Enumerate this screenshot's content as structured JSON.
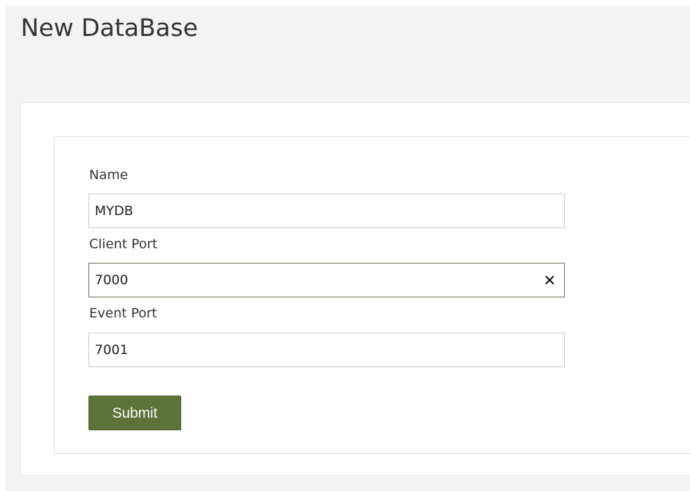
{
  "page": {
    "title": "New DataBase"
  },
  "form": {
    "name": {
      "label": "Name",
      "value": "MYDB"
    },
    "client_port": {
      "label": "Client Port",
      "value": "7000"
    },
    "event_port": {
      "label": "Event Port",
      "value": "7001"
    },
    "submit_label": "Submit"
  },
  "colors": {
    "page_background": "#f2f3f5",
    "submit_button": "#5b7238",
    "focused_border": "#5c6d45"
  },
  "icons": {
    "clear": "close-icon"
  }
}
